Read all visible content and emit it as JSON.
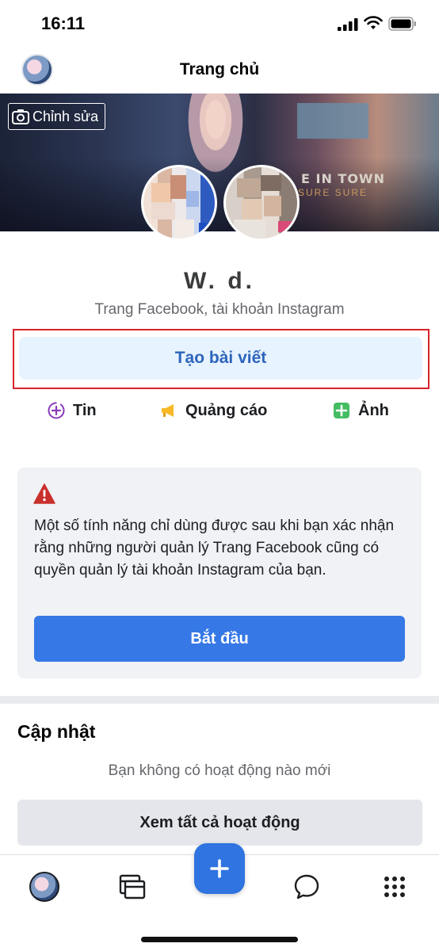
{
  "status_bar": {
    "time": "16:11"
  },
  "header": {
    "title": "Trang chủ"
  },
  "cover": {
    "edit_label": "Chỉnh sửa",
    "sign_text": "E IN TOWN",
    "sign_subtext": "SURE SURE"
  },
  "page": {
    "name": "W. d.",
    "subtitle": "Trang Facebook, tài khoản Instagram"
  },
  "create_post": {
    "label": "Tạo bài viết"
  },
  "actions": [
    {
      "label": "Tin",
      "icon": "story-plus-icon",
      "color": "#8a3ab9"
    },
    {
      "label": "Quảng cáo",
      "icon": "megaphone-icon",
      "color": "#f7b928"
    },
    {
      "label": "Ảnh",
      "icon": "photo-plus-icon",
      "color": "#45bd62"
    }
  ],
  "warning": {
    "icon": "warning-triangle-icon",
    "icon_color": "#c9302c",
    "text": "Một số tính năng chỉ dùng được sau khi bạn xác nhận rằng những người quản lý Trang Facebook cũng có quyền quản lý tài khoản Instagram của bạn.",
    "button_label": "Bắt đầu"
  },
  "updates": {
    "title": "Cập nhật",
    "empty_text": "Bạn không có hoạt động nào mới",
    "see_all_label": "Xem tất cả hoạt động"
  },
  "tab_bar": {
    "items": [
      "profile-avatar",
      "feed-icon",
      "create-plus-icon",
      "messages-icon",
      "menu-grid-icon"
    ]
  },
  "colors": {
    "accent": "#3678e6",
    "highlight_border": "#d9232c"
  }
}
